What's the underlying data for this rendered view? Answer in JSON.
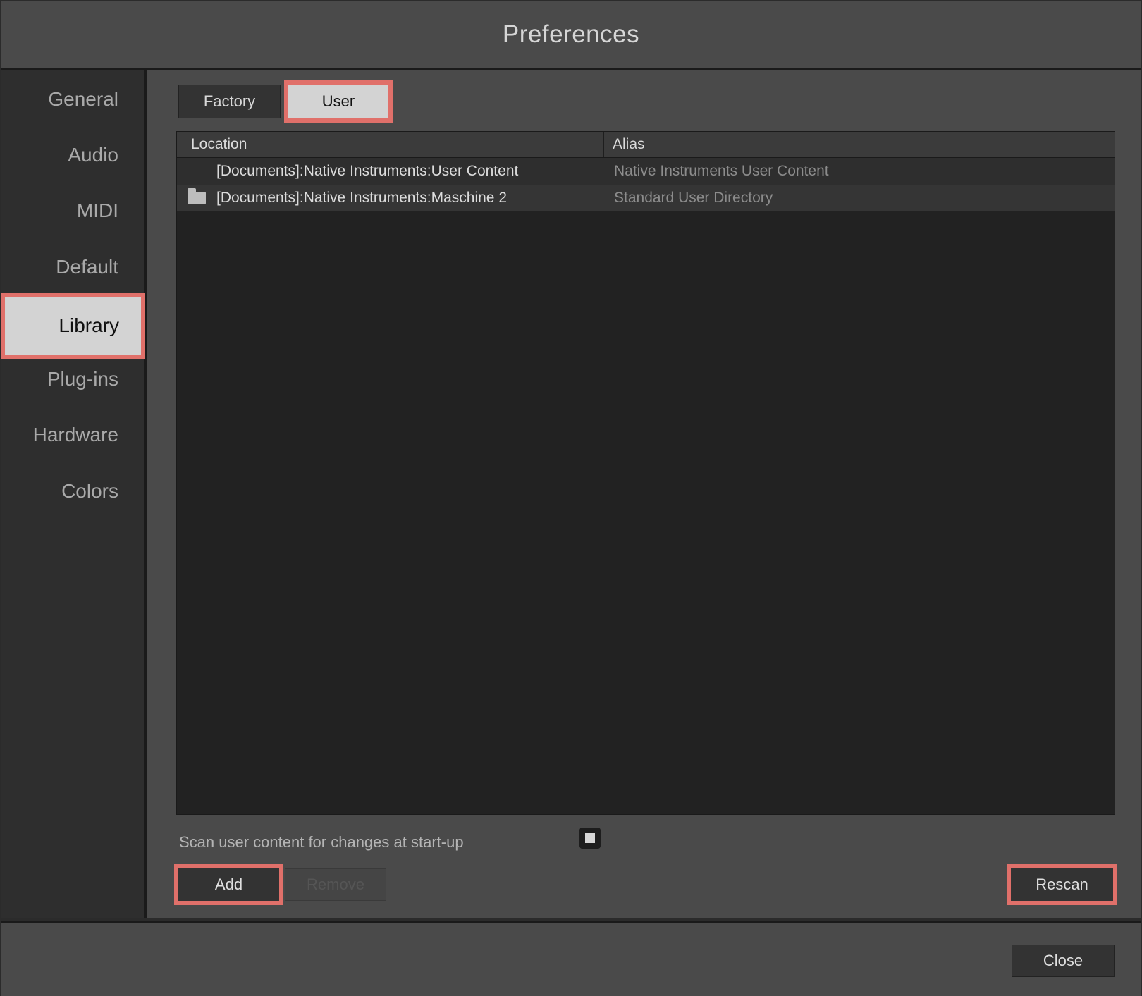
{
  "window": {
    "title": "Preferences"
  },
  "sidebar": {
    "items": [
      {
        "label": "General"
      },
      {
        "label": "Audio"
      },
      {
        "label": "MIDI"
      },
      {
        "label": "Default"
      },
      {
        "label": "Library"
      },
      {
        "label": "Plug-ins"
      },
      {
        "label": "Hardware"
      },
      {
        "label": "Colors"
      }
    ],
    "active": "Library"
  },
  "tabs": [
    {
      "label": "Factory"
    },
    {
      "label": "User"
    }
  ],
  "active_tab": "User",
  "table": {
    "columns": [
      {
        "label": "Location"
      },
      {
        "label": "Alias"
      }
    ],
    "rows": [
      {
        "location": "[Documents]:Native Instruments:User Content",
        "alias": "Native Instruments User Content",
        "icon": "none"
      },
      {
        "location": "[Documents]:Native Instruments:Maschine 2",
        "alias": "Standard User Directory",
        "icon": "folder-icon"
      }
    ]
  },
  "scan_option": {
    "label": "Scan user content for changes at start-up",
    "checked": true
  },
  "buttons": {
    "add": "Add",
    "remove": "Remove",
    "rescan": "Rescan",
    "close": "Close"
  },
  "colors": {
    "highlight": "#e0706a",
    "active_bg": "#d3d3d3",
    "panel_bg": "#4a4a4a"
  }
}
